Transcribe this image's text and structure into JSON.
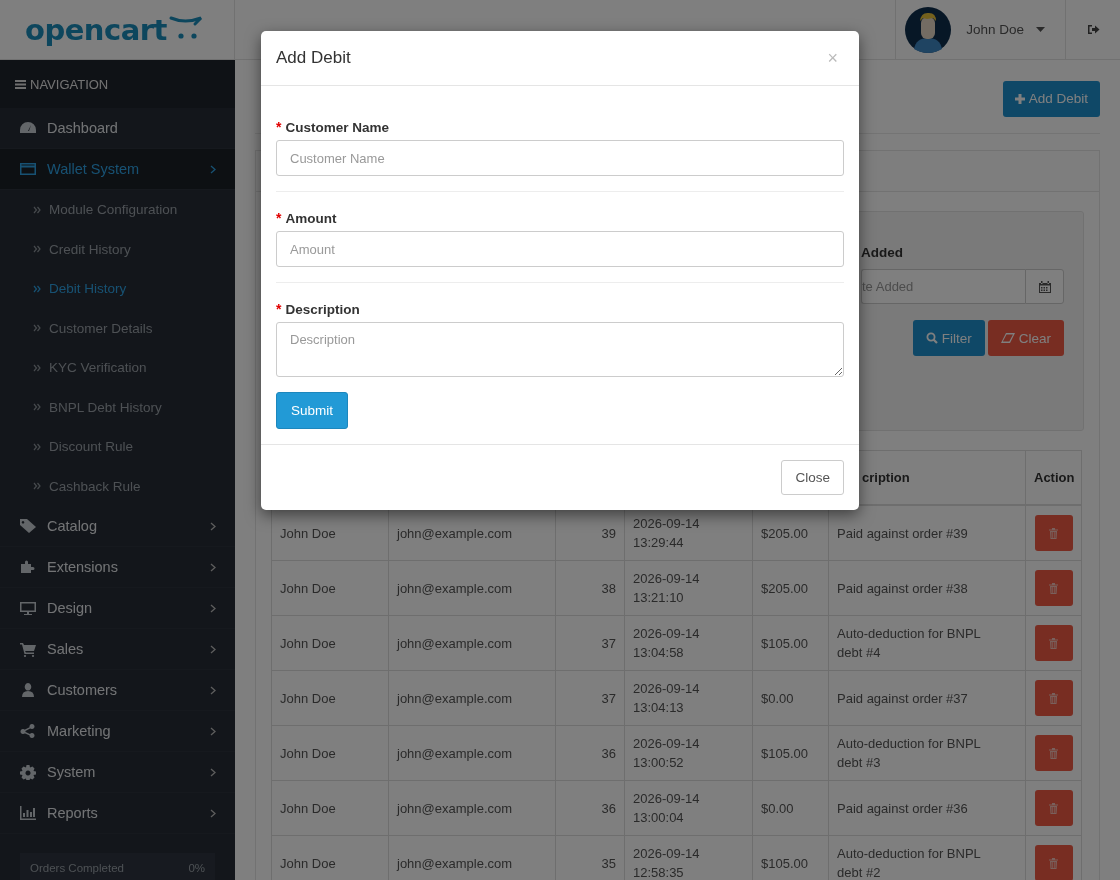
{
  "logo": {
    "text": "opencart"
  },
  "user": {
    "name": "John Doe"
  },
  "sidebar": {
    "heading": "NAVIGATION",
    "items": [
      {
        "label": "Dashboard",
        "expandable": false,
        "selected": false
      },
      {
        "label": "Wallet System",
        "expandable": true,
        "selected": true,
        "children": [
          {
            "label": "Module Configuration",
            "selected": false
          },
          {
            "label": "Credit History",
            "selected": false
          },
          {
            "label": "Debit History",
            "selected": true
          },
          {
            "label": "Customer Details",
            "selected": false
          },
          {
            "label": "KYC Verification",
            "selected": false
          },
          {
            "label": "BNPL Debt History",
            "selected": false
          },
          {
            "label": "Discount Rule",
            "selected": false
          },
          {
            "label": "Cashback Rule",
            "selected": false
          }
        ]
      },
      {
        "label": "Catalog",
        "expandable": true,
        "selected": false
      },
      {
        "label": "Extensions",
        "expandable": true,
        "selected": false
      },
      {
        "label": "Design",
        "expandable": true,
        "selected": false
      },
      {
        "label": "Sales",
        "expandable": true,
        "selected": false
      },
      {
        "label": "Customers",
        "expandable": true,
        "selected": false
      },
      {
        "label": "Marketing",
        "expandable": true,
        "selected": false
      },
      {
        "label": "System",
        "expandable": true,
        "selected": false
      },
      {
        "label": "Reports",
        "expandable": true,
        "selected": false
      }
    ],
    "progress": {
      "label": "Orders Completed",
      "value": "0%"
    }
  },
  "page": {
    "add_button": "Add Debit"
  },
  "filter": {
    "label": "Added",
    "placeholder": "te Added",
    "buttons": [
      {
        "label": "Filter",
        "kind": "filter"
      },
      {
        "label": "Clear",
        "kind": "clear"
      }
    ]
  },
  "table": {
    "columns": [
      {
        "label": "cription"
      },
      {
        "label": "Action"
      }
    ],
    "rows": [
      {
        "name": "John Doe",
        "email": "john@example.com",
        "order": "39",
        "date": "2026-09-14 13:29:44",
        "amount": "$205.00",
        "description": "Paid against order #39"
      },
      {
        "name": "John Doe",
        "email": "john@example.com",
        "order": "38",
        "date": "2026-09-14 13:21:10",
        "amount": "$205.00",
        "description": "Paid against order #38"
      },
      {
        "name": "John Doe",
        "email": "john@example.com",
        "order": "37",
        "date": "2026-09-14 13:04:58",
        "amount": "$105.00",
        "description": "Auto-deduction for BNPL debt #4"
      },
      {
        "name": "John Doe",
        "email": "john@example.com",
        "order": "37",
        "date": "2026-09-14 13:04:13",
        "amount": "$0.00",
        "description": "Paid against order #37"
      },
      {
        "name": "John Doe",
        "email": "john@example.com",
        "order": "36",
        "date": "2026-09-14 13:00:52",
        "amount": "$105.00",
        "description": "Auto-deduction for BNPL debt #3"
      },
      {
        "name": "John Doe",
        "email": "john@example.com",
        "order": "36",
        "date": "2026-09-14 13:00:04",
        "amount": "$0.00",
        "description": "Paid against order #36"
      },
      {
        "name": "John Doe",
        "email": "john@example.com",
        "order": "35",
        "date": "2026-09-14 12:58:35",
        "amount": "$105.00",
        "description": "Auto-deduction for BNPL debt #2"
      }
    ]
  },
  "modal": {
    "title": "Add Debit",
    "close_glyph": "×",
    "fields": [
      {
        "label": "Customer Name",
        "placeholder": "Customer Name",
        "required": true,
        "kind": "input"
      },
      {
        "label": "Amount",
        "placeholder": "Amount",
        "required": true,
        "kind": "input"
      },
      {
        "label": "Description",
        "placeholder": "Description",
        "required": true,
        "kind": "textarea"
      }
    ],
    "required_mark": "*",
    "submit": "Submit",
    "footer_button": "Close"
  }
}
